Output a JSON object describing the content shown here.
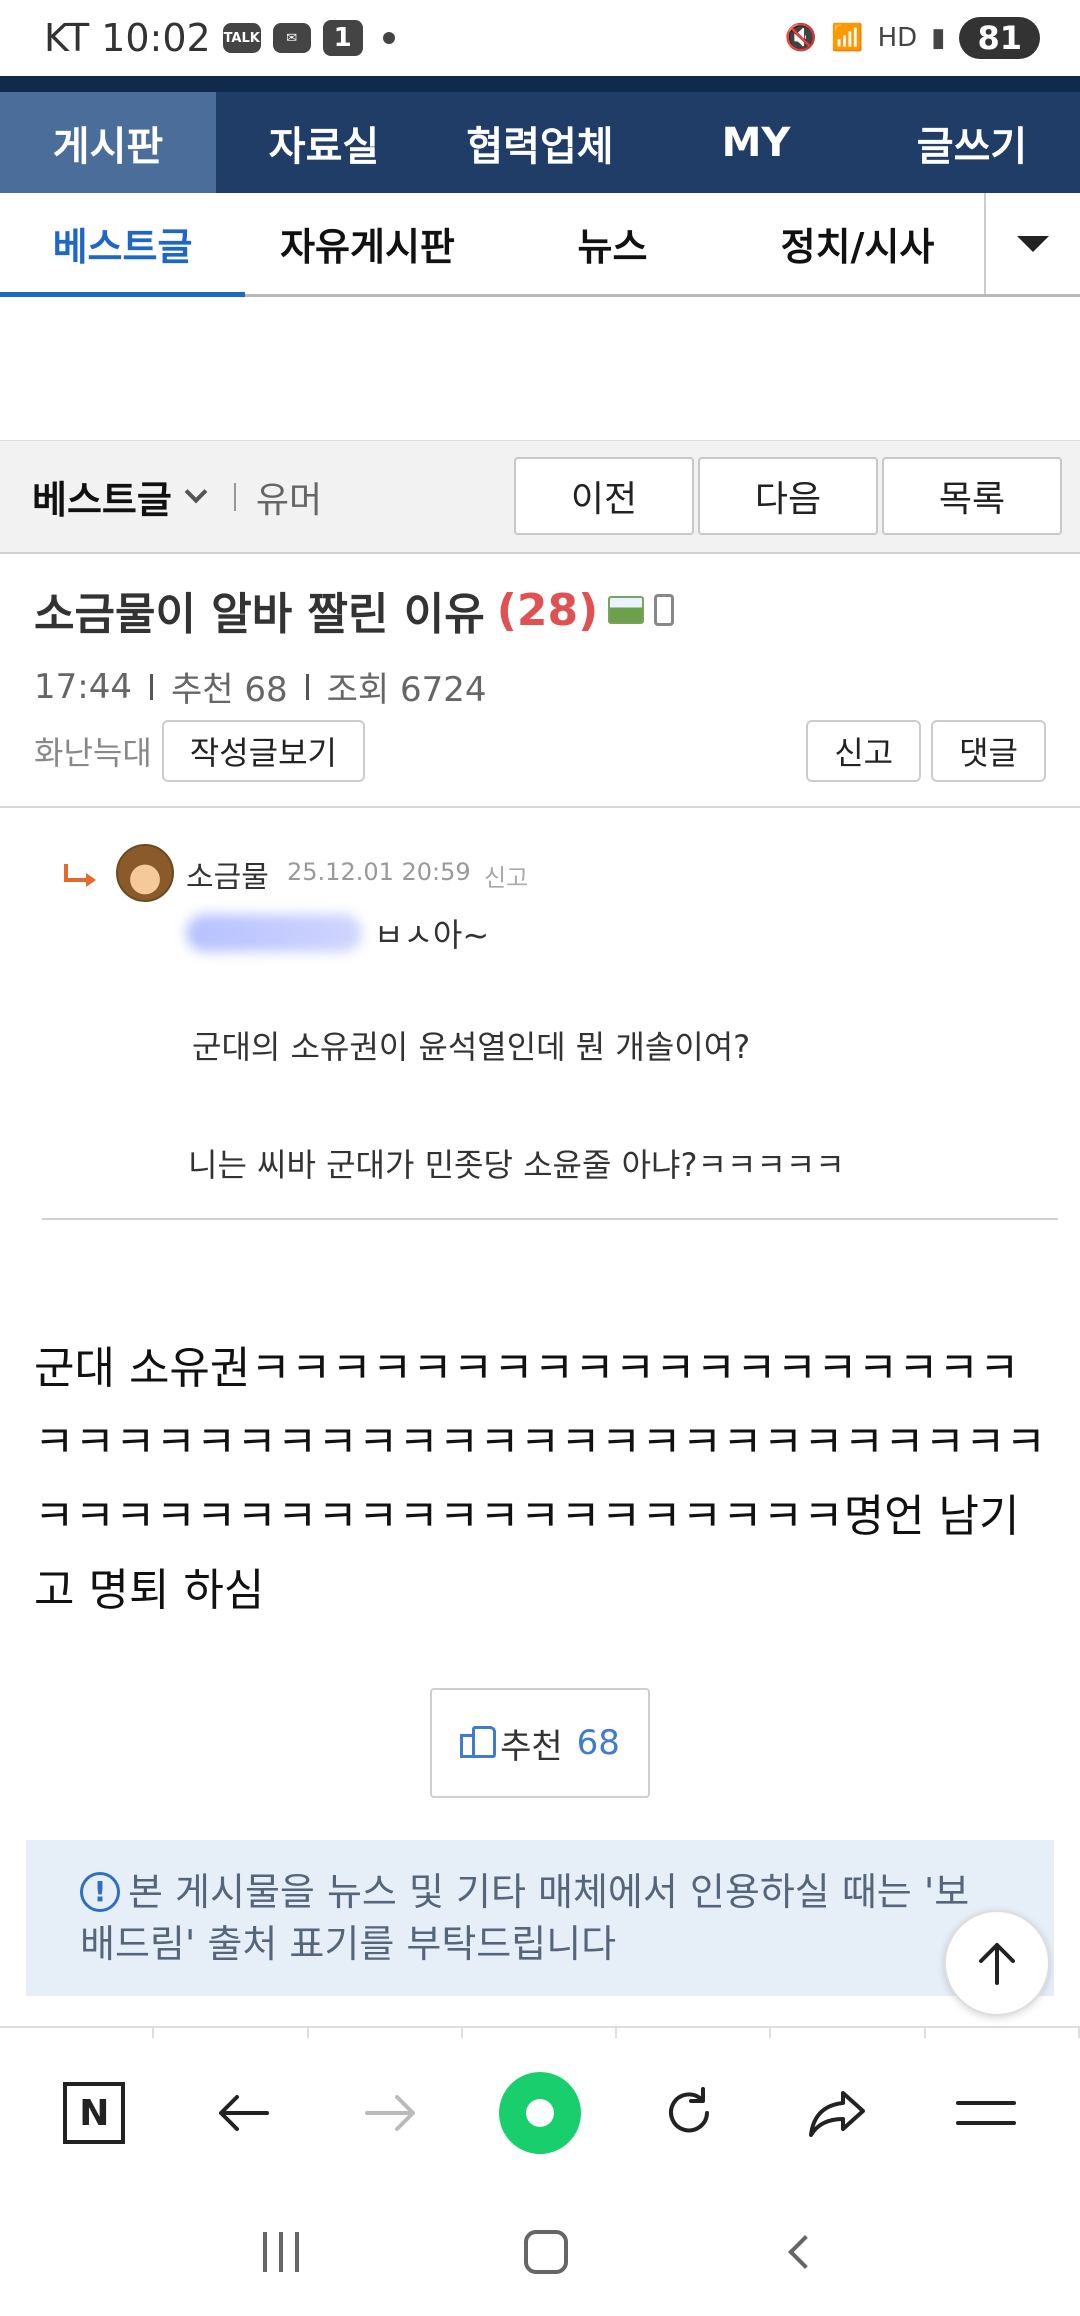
{
  "status_bar": {
    "carrier": "KT",
    "time": "10:02",
    "talk_label": "TALK",
    "notif_count": "1",
    "battery": "81"
  },
  "main_nav": {
    "items": [
      "게시판",
      "자료실",
      "협력업체",
      "MY",
      "글쓰기"
    ]
  },
  "sub_nav": {
    "tabs": [
      "베스트글",
      "자유게시판",
      "뉴스",
      "정치/시사"
    ]
  },
  "board_bar": {
    "board_name": "베스트글",
    "category": "유머",
    "prev_label": "이전",
    "next_label": "다음",
    "list_label": "목록"
  },
  "post": {
    "title": "소금물이 알바 짤린 이유",
    "comment_count": "(28)",
    "time": "17:44",
    "recommend": "추천 68",
    "views": "조회 6724",
    "author": "화난늑대",
    "author_posts_label": "작성글보기",
    "report_label": "신고",
    "comment_label": "댓글",
    "body": "군대 소유권ㅋㅋㅋㅋㅋㅋㅋㅋㅋㅋㅋㅋㅋㅋㅋㅋㅋㅋㅋㅋㅋㅋㅋㅋㅋㅋㅋㅋㅋㅋㅋㅋㅋㅋㅋㅋㅋㅋㅋㅋㅋㅋㅋㅋㅋㅋㅋㅋㅋㅋㅋㅋㅋㅋㅋㅋㅋㅋㅋㅋㅋㅋㅋㅋ명언 남기고 명퇴 하심"
  },
  "quote": {
    "username": "소금물",
    "date": "25.12.01 20:59",
    "report": "신고",
    "line1": "ㅂㅅ아~",
    "line2": "군대의 소유권이 윤석열인데 뭔 개솔이여?",
    "line3": "니는 씨바 군대가 민좃당 소윤줄 아냐?ㅋㅋㅋㅋㅋ"
  },
  "recommend_button": {
    "label": "추천",
    "count": "68"
  },
  "notice": {
    "icon": "!",
    "text": "본 게시물을 뉴스 및 기타 매체에서 인용하실 때는 '보배드림' 출처 표기를 부탁드립니다"
  },
  "toolbar": {
    "icons": [
      "naver-n-icon",
      "back-arrow-icon",
      "forward-arrow-icon",
      "green-dot-icon",
      "refresh-icon",
      "share-icon",
      "menu-icon"
    ],
    "n_label": "N"
  },
  "accent_colors": {
    "nav_bg": "#1f3d66",
    "active_tab": "#1d67c7",
    "count_red": "#e05252",
    "green": "#19ce6c"
  }
}
